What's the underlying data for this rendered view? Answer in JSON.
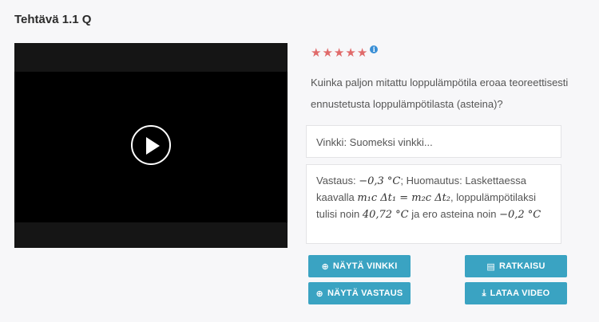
{
  "page": {
    "title": "Tehtävä 1.1 Q"
  },
  "rating": {
    "stars": [
      "★",
      "★",
      "★",
      "★",
      "★"
    ],
    "info_label": "i",
    "star_color": "#e06a6a"
  },
  "question": "Kuinka paljon mitattu loppulämpötila eroaa teoreettisesti ennustetusta loppulämpötilasta (asteina)?",
  "hint": {
    "text": "Vinkki: Suomeksi vinkki..."
  },
  "answer": {
    "p1": "Vastaus: ",
    "m1": "−0,3 °C",
    "p2": "; Huomautus: Laskettaessa kaavalla ",
    "m2": "m₁c Δt₁ = m₂c Δt₂",
    "p3": ", loppulämpötilaksi tulisi noin ",
    "m3": "40,72 °C",
    "p4": " ja ero asteina noin ",
    "m4": "−0,2 °C"
  },
  "buttons": {
    "show_hint": "Näytä vinkki",
    "solution": "Ratkaisu",
    "show_answer": "Näytä vastaus",
    "download_video": "Lataa video"
  },
  "colors": {
    "button": "#3aa3c2",
    "video_bg": "#151515"
  }
}
